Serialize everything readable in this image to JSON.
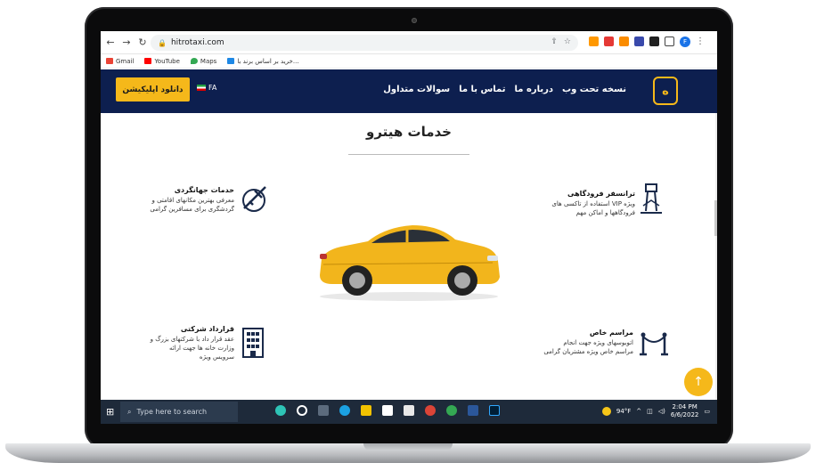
{
  "browser": {
    "url": "hitrotaxi.com",
    "bookmarks": [
      "Gmail",
      "YouTube",
      "Maps",
      "خرید بر اساس برند با..."
    ]
  },
  "site_nav": {
    "download_button": "دانلود اپلیکیشن",
    "language": "FA",
    "menu": [
      "نسخه تحت وب",
      "درباره ما",
      "تماس با ما",
      "سوالات متداول"
    ]
  },
  "section": {
    "title": "خدمات هیترو"
  },
  "services": {
    "tourism": {
      "title": "خدمات جهانگردی",
      "desc_1": "معرفی بهترین مکانهای اقامتی و",
      "desc_2": "گردشگری برای مسافرین گرامی"
    },
    "airport": {
      "title": "ترانسفر فرودگاهی",
      "desc_1": "استفاده از تاکسی های VIP ویژه",
      "desc_2": "فرودگاهها و اماکن مهم"
    },
    "corporate": {
      "title": "قرارداد شرکتی",
      "desc_1": "عقد قرار داد با شرکتهای بزرگ و",
      "desc_2": "وزارت خانه ها جهت ارائه",
      "desc_3": "سرویس ویژه"
    },
    "ceremony": {
      "title": "مراسم خاص",
      "desc_1": "اتوبوسهای ویژه جهت انجام",
      "desc_2": "مراسم خاص ویژه مشتریان گرامی"
    }
  },
  "taskbar": {
    "search_placeholder": "Type here to search",
    "weather": "94°F",
    "time": "2:04 PM",
    "date": "6/6/2022"
  },
  "colors": {
    "navy": "#0d1f4f",
    "accent": "#f5b81a"
  }
}
